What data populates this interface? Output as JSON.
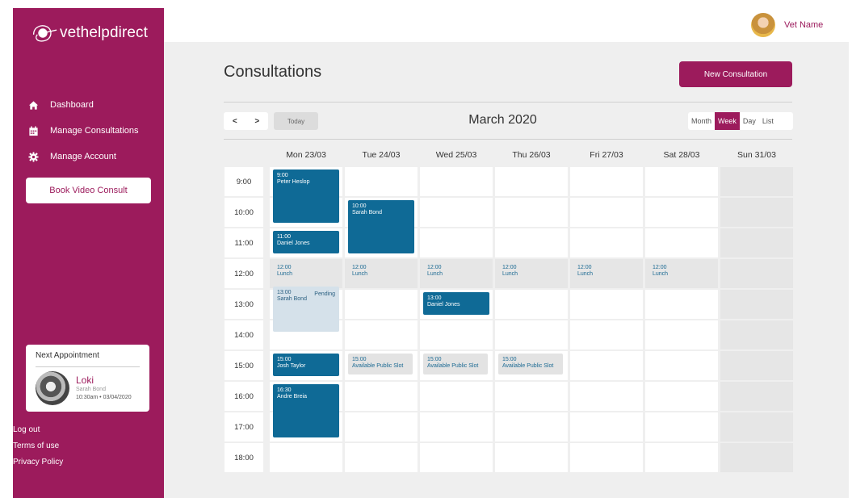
{
  "brand": {
    "name": "vethelpdirect"
  },
  "sidebar": {
    "nav": [
      {
        "label": "Dashboard",
        "icon": "home-icon"
      },
      {
        "label": "Manage Consultations",
        "icon": "calendar-icon"
      },
      {
        "label": "Manage Account",
        "icon": "gear-icon"
      }
    ],
    "book_button": "Book Video Consult",
    "next_appointment": {
      "title": "Next Appointment",
      "pet": "Loki",
      "owner": "Sarah Bond",
      "datetime": "10:30am • 03/04/2020"
    },
    "links": [
      "Log out",
      "Terms of use",
      "Privacy Policy"
    ]
  },
  "topbar": {
    "user_name": "Vet Name"
  },
  "main": {
    "title": "Consultations",
    "new_button": "New Consultation",
    "nav_prev": "<",
    "nav_next": ">",
    "today": "Today",
    "month_label": "March 2020",
    "views": [
      "Month",
      "Week",
      "Day",
      "List"
    ],
    "active_view": "Week"
  },
  "calendar": {
    "days": [
      "Mon 23/03",
      "Tue 24/03",
      "Wed 25/03",
      "Thu 26/03",
      "Fri 27/03",
      "Sat 28/03",
      "Sun 31/03"
    ],
    "hours": [
      "9:00",
      "10:00",
      "11:00",
      "12:00",
      "13:00",
      "14:00",
      "15:00",
      "16:00",
      "17:00",
      "18:00"
    ],
    "events": [
      {
        "day": 0,
        "time": "9:00",
        "name": "Peter Heslop",
        "kind": "booked"
      },
      {
        "day": 1,
        "time": "10:00",
        "name": "Sarah Bond",
        "kind": "booked"
      },
      {
        "day": 0,
        "time": "11:00",
        "name": "Daniel Jones",
        "kind": "booked"
      },
      {
        "day": 0,
        "time": "12:00",
        "name": "Lunch",
        "kind": "lunch"
      },
      {
        "day": 1,
        "time": "12:00",
        "name": "Lunch",
        "kind": "lunch"
      },
      {
        "day": 2,
        "time": "12:00",
        "name": "Lunch",
        "kind": "lunch"
      },
      {
        "day": 3,
        "time": "12:00",
        "name": "Lunch",
        "kind": "lunch"
      },
      {
        "day": 4,
        "time": "12:00",
        "name": "Lunch",
        "kind": "lunch"
      },
      {
        "day": 5,
        "time": "12:00",
        "name": "Lunch",
        "kind": "lunch"
      },
      {
        "day": 2,
        "time": "13:00",
        "name": "Daniel Jones",
        "kind": "booked"
      },
      {
        "day": 0,
        "time": "13:00",
        "name": "Sarah Bond",
        "kind": "pending",
        "tag": "Pending"
      },
      {
        "day": 0,
        "time": "15:00",
        "name": "Josh Taylor",
        "kind": "booked"
      },
      {
        "day": 1,
        "time": "15:00",
        "name": "Available Public Slot",
        "kind": "slot"
      },
      {
        "day": 2,
        "time": "15:00",
        "name": "Available Public Slot",
        "kind": "slot"
      },
      {
        "day": 3,
        "time": "15:00",
        "name": "Available Public Slot",
        "kind": "slot"
      },
      {
        "day": 0,
        "time": "16:30",
        "name": "Andre Breia",
        "kind": "booked"
      }
    ]
  },
  "colors": {
    "brand": "#9c1b5c",
    "booked": "#0f6a96",
    "pending": "#d5e1ea",
    "background": "#efefef"
  }
}
